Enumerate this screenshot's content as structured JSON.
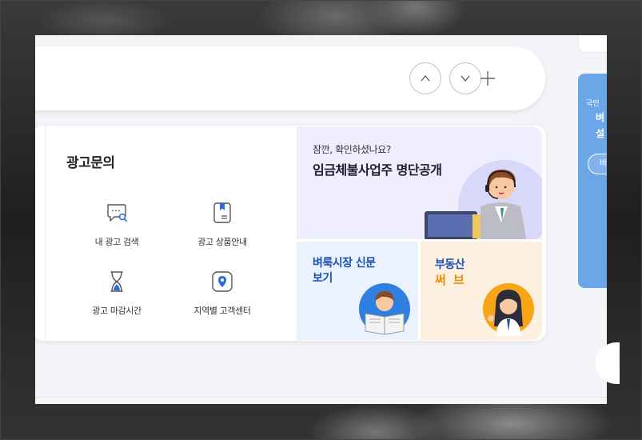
{
  "ad_inquiry": {
    "title": "광고문의",
    "items": [
      {
        "label": "내 광고 검색",
        "icon": "chat-search-icon"
      },
      {
        "label": "광고 상품안내",
        "icon": "bookmark-doc-icon"
      },
      {
        "label": "광고 마감시간",
        "icon": "hourglass-icon"
      },
      {
        "label": "지역별 고객센터",
        "icon": "location-pin-icon"
      }
    ]
  },
  "banners": {
    "wage": {
      "small": "잠깐, 확인하셨나요?",
      "big": "임금체불사업주 명단공개"
    },
    "flea_market": {
      "title": "벼룩시장 신문보기"
    },
    "real_estate": {
      "line1": "부동산",
      "line2": "써 브"
    }
  },
  "side_banner": {
    "line1": "국민",
    "line2": "벼",
    "line3": "설",
    "button": "바"
  },
  "colors": {
    "accent_blue": "#1e4fb6",
    "accent_orange": "#f08a00",
    "banner_purple": "#efeefe",
    "banner_blue": "#e9f2fd",
    "banner_peach": "#fdf0e0"
  }
}
